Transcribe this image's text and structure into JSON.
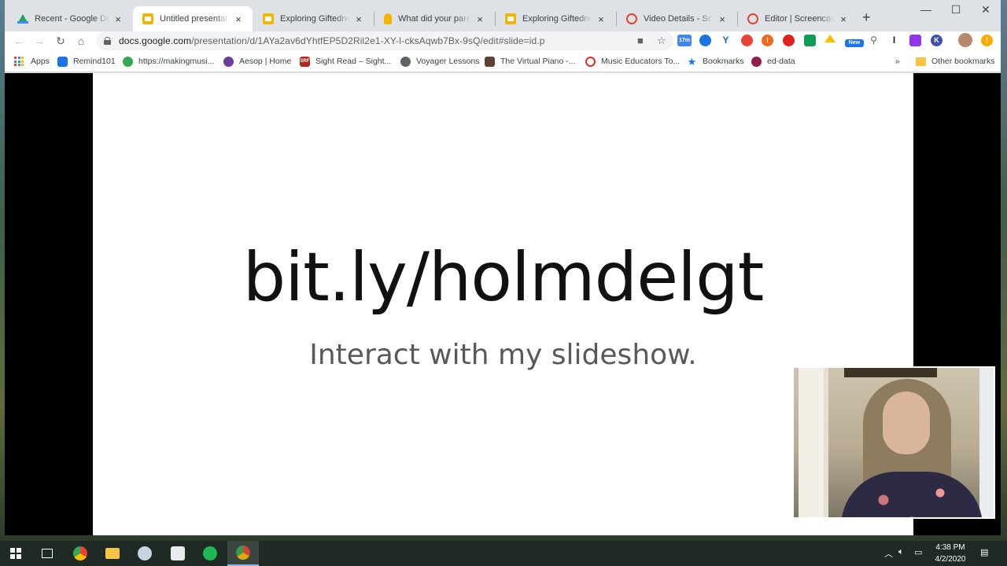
{
  "browser": {
    "tabs": [
      {
        "title": "Recent - Google Drive",
        "icon": "drive-icon"
      },
      {
        "title": "Untitled presentation - Google Slides",
        "icon": "slides-icon",
        "active": true
      },
      {
        "title": "Exploring Giftedness - Google Slides",
        "icon": "slides-icon"
      },
      {
        "title": "What did your parents",
        "icon": "hand-icon"
      },
      {
        "title": "Exploring Giftedness - Google Slides",
        "icon": "slides-icon"
      },
      {
        "title": "Video Details - Screencastify",
        "icon": "screencastify-icon"
      },
      {
        "title": "Editor | Screencastify Studio",
        "icon": "screencastify-icon"
      }
    ],
    "close_glyph": "×",
    "new_tab_glyph": "+",
    "window_controls": {
      "minimize": "—",
      "maximize": "☐",
      "close": "✕"
    },
    "url": {
      "host": "docs.google.com",
      "path": "/presentation/d/1AYa2av6dYhtfEP5D2Ril2e1-XY-I-cksAqwb7Bx-9sQ/edit#slide=id.p"
    },
    "extension_badges": {
      "counter": "17m",
      "new": "New",
      "letter_i": "I",
      "letter_k": "K"
    },
    "bookmarks": [
      {
        "label": "Apps"
      },
      {
        "label": "Remind101"
      },
      {
        "label": "https://makingmusi..."
      },
      {
        "label": "Aesop | Home"
      },
      {
        "label": "Sight Read – Sight..."
      },
      {
        "label": "Voyager Lessons"
      },
      {
        "label": "The Virtual Piano -..."
      },
      {
        "label": "Music Educators To..."
      },
      {
        "label": "Bookmarks"
      },
      {
        "label": "ed-data"
      }
    ],
    "bookmarks_overflow": "»",
    "other_bookmarks": "Other bookmarks"
  },
  "slide": {
    "title": "bit.ly/holmdelgt",
    "subtitle": "Interact with my slideshow."
  },
  "taskbar": {
    "clock_time": "4:38 PM",
    "clock_date": "4/2/2020"
  },
  "colors": {
    "slides_yellow": "#f4b400",
    "chrome_frame": "#dee1e6",
    "slide_title": "#111111",
    "slide_subtitle": "#595959"
  }
}
